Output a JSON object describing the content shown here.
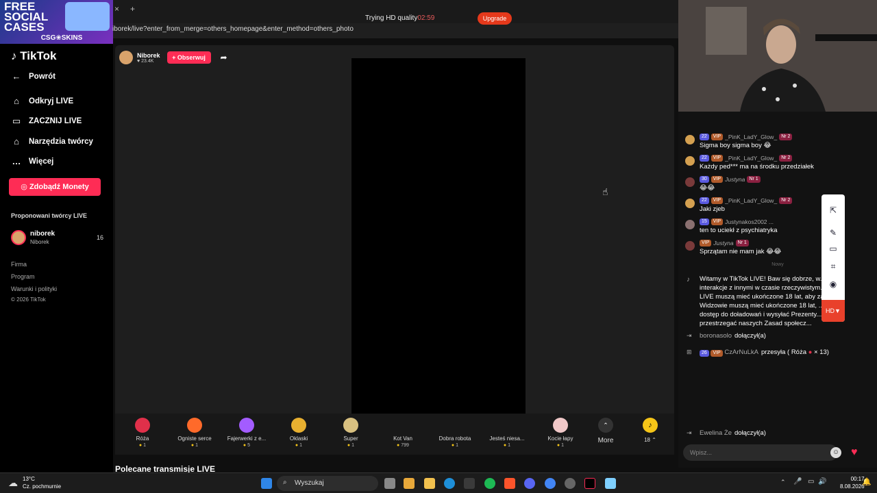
{
  "browser": {
    "promo_title": "FREE SOCIAL CASES",
    "promo_brand": "CSG❀SKINS",
    "tab_close": "×",
    "tab_new": "+",
    "address": "iborek/live?enter_from_merge=others_homepage&enter_method=others_photo",
    "recording_label": "Trying HD quality",
    "recording_time": "02:59",
    "upgrade_label": "Upgrade"
  },
  "sidebar": {
    "logo": "TikTok",
    "back": "Powrót",
    "items": [
      {
        "label": "Odkryj LIVE",
        "icon": "⌂"
      },
      {
        "label": "ZACZNIJ LIVE",
        "icon": "▭"
      },
      {
        "label": "Narzędzia twórcy",
        "icon": "⌂"
      },
      {
        "label": "Więcej",
        "icon": "…"
      }
    ],
    "coins_button": "Zdobądź Monety",
    "suggested_title": "Proponowani twórcy LIVE",
    "suggested_creator": {
      "name": "niborek",
      "handle": "Niborek",
      "count": "16"
    },
    "footer": [
      "Firma",
      "Program",
      "Warunki i polityki",
      "© 2026 TikTok"
    ]
  },
  "stream": {
    "host_name": "Niborek",
    "host_likes": "23.4K",
    "follow_label": "+ Obserwuj",
    "below_title": "Polecane transmisje LIVE",
    "gifts": [
      {
        "name": "Róża",
        "price": "1",
        "color": "#e0304a"
      },
      {
        "name": "Ogniste serce",
        "price": "1",
        "color": "#ff6a2a"
      },
      {
        "name": "Fajerwerki z e...",
        "price": "5",
        "color": "#a35cff"
      },
      {
        "name": "Oklaski",
        "price": "1",
        "color": "#e8b030"
      },
      {
        "name": "Super",
        "price": "1",
        "color": "#d8c080"
      },
      {
        "name": "Kot Van",
        "price": "799",
        "color": "#888"
      },
      {
        "name": "Dobra robota",
        "price": "1",
        "color": "#777"
      },
      {
        "name": "Jesteś niesa...",
        "price": "1",
        "color": "#777"
      },
      {
        "name": "Kocie łapy",
        "price": "1",
        "color": "#f0c8c8"
      }
    ],
    "more_label": "More",
    "coin_count": "18"
  },
  "chat": {
    "messages": [
      {
        "level": "22",
        "vip": "VIP",
        "user": "_PinK_LadY_Glow_",
        "rank": "Nr 2",
        "text": "Sigma boy sigma boy 😂"
      },
      {
        "level": "22",
        "vip": "VIP",
        "user": "_PinK_LadY_Glow_",
        "rank": "Nr 2",
        "text": "Każdy ped*** ma na środku przedziałek"
      },
      {
        "level": "30",
        "vip": "VIP",
        "user": "Justyna",
        "rank": "Nr 1",
        "text": "😂😂"
      },
      {
        "level": "22",
        "vip": "VIP",
        "user": "_PinK_LadY_Glow_",
        "rank": "Nr 2",
        "text": "Jaki zjeb"
      },
      {
        "level": "15",
        "vip": "VIP",
        "user": "Justynakos2002 ...",
        "rank": "",
        "text": "ten to uciekł z psychiatryka"
      },
      {
        "level": "",
        "vip": "VIP",
        "user": "Justyna",
        "rank": "Nr 1",
        "text": "Sprzątam nie mam jak 😂😂"
      }
    ],
    "divider": "Nowy",
    "system_message": "Witamy w TikTok LIVE! Baw się dobrze, w... c w interakcje z innymi w czasie rzeczywistym... y LIVE muszą mieć ukończone 18 lat, aby zaczą... Widzowie muszą mieć ukończone 18 lat, ... dostęp do doładowań i wysyłać Prezenty... aj, aby przestrzegać naszych Zasad społecz...",
    "join1_user": "boronasolo",
    "join1_text": "dołączył(a)",
    "gift_level": "26",
    "gift_vip": "VIP",
    "gift_user": "CzArNuLkA",
    "gift_text": "przesyła ( Róża",
    "gift_count": "× 13)",
    "join2_user": "Ewelina Że",
    "join2_text": "dołączył(a)",
    "input_placeholder": "Wpisz..."
  },
  "toolbox": {
    "hd_label": "HD▼"
  },
  "taskbar": {
    "temperature": "13°C",
    "weather": "Cz. pochmurnie",
    "search": "Wyszukaj",
    "time": "00:17",
    "date": "8.08.2026"
  }
}
